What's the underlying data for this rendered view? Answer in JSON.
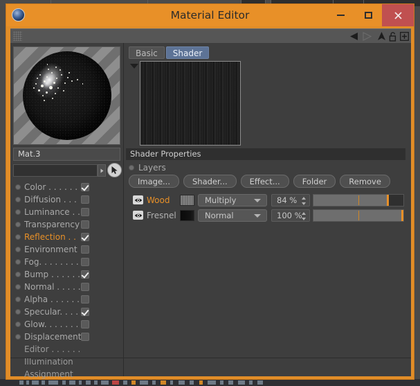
{
  "window": {
    "title": "Material Editor",
    "logo_icon": "cinema4d-logo-icon",
    "minimize_label": "–",
    "maximize_label": "□",
    "close_label": "✕",
    "accent_color": "#e89028",
    "close_color": "#c05050"
  },
  "toolstrip": {
    "grip_icon": "drag-grip-icon",
    "icons": [
      {
        "name": "back-arrow-icon",
        "glyph": "◀"
      },
      {
        "name": "forward-arrow-icon",
        "glyph": "▷"
      },
      {
        "name": "up-arrow-icon",
        "glyph": "▲"
      },
      {
        "name": "lock-open-icon",
        "glyph": "🔓"
      },
      {
        "name": "add-box-icon",
        "glyph": "⊞"
      }
    ]
  },
  "left_panel": {
    "preview_icon": "material-sphere-preview",
    "name_value": "Mat.3",
    "link_field_value": "",
    "link_arrow_icon": "dropdown-arrow-icon",
    "picker_icon": "cursor-picker-icon",
    "channels": [
      {
        "label": "Color . . . . . . .",
        "checked": true,
        "selected": false,
        "has_box": true
      },
      {
        "label": "Diffusion . . .",
        "checked": false,
        "selected": false,
        "has_box": true
      },
      {
        "label": "Luminance . .",
        "checked": false,
        "selected": false,
        "has_box": true
      },
      {
        "label": "Transparency",
        "checked": false,
        "selected": false,
        "has_box": true
      },
      {
        "label": "Reflection . .",
        "checked": true,
        "selected": true,
        "has_box": true
      },
      {
        "label": "Environment",
        "checked": false,
        "selected": false,
        "has_box": true
      },
      {
        "label": "Fog. . . . . . . .",
        "checked": false,
        "selected": false,
        "has_box": true
      },
      {
        "label": "Bump . . . . . .",
        "checked": true,
        "selected": false,
        "has_box": true
      },
      {
        "label": "Normal . . . . .",
        "checked": false,
        "selected": false,
        "has_box": true
      },
      {
        "label": "Alpha . . . . . .",
        "checked": false,
        "selected": false,
        "has_box": true
      },
      {
        "label": "Specular. . . .",
        "checked": true,
        "selected": false,
        "has_box": true
      },
      {
        "label": "Glow. . . . . . .",
        "checked": false,
        "selected": false,
        "has_box": true
      },
      {
        "label": "Displacement",
        "checked": false,
        "selected": false,
        "has_box": true
      },
      {
        "label": "Editor . . . . . .",
        "checked": false,
        "selected": false,
        "has_box": false
      },
      {
        "label": "Illumination",
        "checked": false,
        "selected": false,
        "has_box": false
      },
      {
        "label": "Assignment",
        "checked": false,
        "selected": false,
        "has_box": false
      }
    ]
  },
  "right_panel": {
    "tabs": [
      {
        "label": "Basic",
        "active": false
      },
      {
        "label": "Shader",
        "active": true
      }
    ],
    "tree_collapse_icon": "collapse-triangle-icon",
    "texture_preview_icon": "wood-texture-preview",
    "section_title": "Shader Properties",
    "layers_label": "Layers",
    "buttons": [
      {
        "label": "Image..."
      },
      {
        "label": "Shader..."
      },
      {
        "label": "Effect..."
      },
      {
        "label": "Folder"
      },
      {
        "label": "Remove"
      }
    ],
    "layers": [
      {
        "name": "Wood",
        "selected": true,
        "visibility_icon": "eye-icon",
        "thumb_icon": "wood-layer-thumbnail",
        "blend_mode": "Multiply",
        "opacity_label": "84 %",
        "opacity_value": 84
      },
      {
        "name": "Fresnel",
        "selected": false,
        "visibility_icon": "eye-icon",
        "thumb_icon": "fresnel-layer-thumbnail",
        "blend_mode": "Normal",
        "opacity_label": "100 %",
        "opacity_value": 100
      }
    ]
  }
}
